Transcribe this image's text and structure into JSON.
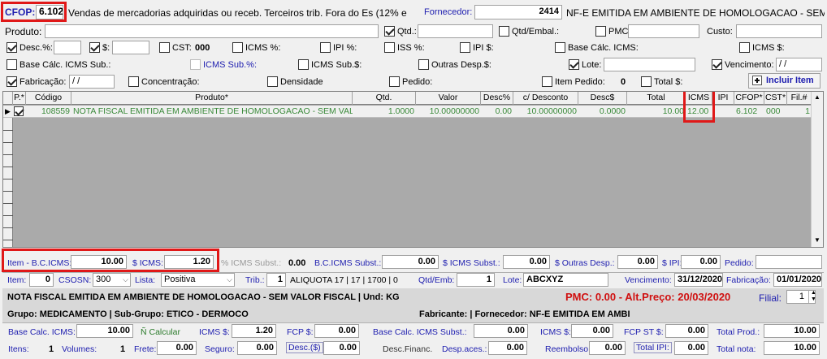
{
  "cfop": {
    "label": "CFOP:",
    "value": "6.102",
    "description": "Vendas de mercadorias adquiridas ou receb. Terceiros trib. Fora do Es (12% e"
  },
  "fornecedor": {
    "label": "Fornecedor:",
    "code": "2414",
    "name": "NF-E EMITIDA EM AMBIENTE DE HOMOLOGACAO - SEM V"
  },
  "produto_label": "Produto:",
  "checks": {
    "qtd": "Qtd.:",
    "qtd_embal": "Qtd/Embal.:",
    "pmc": "PMC:",
    "custo": "Custo:",
    "desc_pct": "Desc.%:",
    "dollar": "$:",
    "cst": "CST:",
    "cst_value": "000",
    "icms_pct": "ICMS %:",
    "ipi_pct": "IPI %:",
    "iss_pct": "ISS %:",
    "ipi_val": "IPI $:",
    "base_calc_icms": "Base Cálc. ICMS:",
    "icms_val": "ICMS $:",
    "base_calc_icms_sub": "Base Cálc. ICMS Sub.:",
    "icms_sub_pct": "ICMS Sub.%:",
    "icms_sub_val": "ICMS Sub.$:",
    "outras_desp": "Outras Desp.$:",
    "lote": "Lote:",
    "vencimento": "Vencimento:",
    "vencimento_value": "/  /",
    "fabricacao": "Fabricação:",
    "fabricacao_value": "/  /",
    "concentracao": "Concentração:",
    "densidade": "Densidade",
    "pedido": "Pedido:",
    "item_pedido": "Item Pedido:",
    "item_pedido_value": "0",
    "total_val": "Total $:"
  },
  "incluir_button": "Incluir Item",
  "grid": {
    "headers": [
      "P.*",
      "Código",
      "Produto*",
      "Qtd.",
      "Valor",
      "Desc%",
      "c/ Desconto",
      "Desc$",
      "Total",
      "ICMS",
      "IPI",
      "CFOP*",
      "CST*",
      "Fil.#"
    ],
    "row": {
      "codigo": "108559",
      "produto": "NOTA FISCAL EMITIDA EM AMBIENTE DE HOMOLOGACAO - SEM VALO",
      "qtd": "1.0000",
      "valor": "10.00000000",
      "desc_pct": "0.00",
      "c_desconto": "10.00000000",
      "desc_val": "0.0000",
      "total": "10.00",
      "icms": "12.00",
      "ipi": "",
      "cfop": "6.102",
      "cst": "000",
      "fil": "1"
    }
  },
  "row1": {
    "item_bc_icms_label": "Item - B.C.ICMS:",
    "item_bc_icms": "10.00",
    "icms_label": "$ ICMS:",
    "icms": "1.20",
    "icms_subst_pct_label": "% ICMS Subst.:",
    "icms_subst_pct": "0.00",
    "bc_icms_subst_label": "B.C.ICMS Subst.:",
    "bc_icms_subst": "0.00",
    "icms_subst_label": "$ ICMS Subst.:",
    "icms_subst": "0.00",
    "outras_desp_label": "$ Outras Desp.:",
    "outras_desp": "0.00",
    "ipi_label": "$ IPI:",
    "ipi": "0.00",
    "pedido_label": "Pedido:"
  },
  "row2": {
    "item_label": "Item:",
    "item": "0",
    "csosn_label": "CSOSN:",
    "csosn": "300",
    "lista_label": "Lista:",
    "lista": "Positiva",
    "trib_label": "Trib.:",
    "trib": "1",
    "aliquota": "ALIQUOTA 17 | 17 | 1700 | 0",
    "qtd_emb_label": "Qtd/Emb:",
    "qtd_emb": "1",
    "lote_label": "Lote:",
    "lote": "ABCXYZ",
    "vencimento_label": "Vencimento:",
    "vencimento": "31/12/2020",
    "fabricacao_label": "Fabricação:",
    "fabricacao": "01/01/2020"
  },
  "info": {
    "product_line": "NOTA FISCAL EMITIDA EM AMBIENTE DE HOMOLOGACAO - SEM VALOR FISCAL | Und: KG",
    "pmc": "PMC:     0.00 - Alt.Preço: 20/03/2020",
    "filial_label": "Filial:",
    "filial": "1",
    "grupo": "Grupo: MEDICAMENTO | Sub-Grupo: ETICO - DERMOCO",
    "fabricante": "Fabricante:  |  Fornecedor: NF-E EMITIDA EM AMBI"
  },
  "totals1": {
    "base_calc_icms_label": "Base Calc. ICMS:",
    "base_calc_icms": "10.00",
    "n_calcular": "Ñ Calcular",
    "icms_label": "ICMS $:",
    "icms": "1.20",
    "fcp_label": "FCP $:",
    "fcp": "0.00",
    "base_icms_subst_label": "Base Calc. ICMS Subst.:",
    "base_icms_subst": "0.00",
    "icms_val_label": "ICMS $:",
    "icms_val": "0.00",
    "fcp_st_label": "FCP ST $:",
    "fcp_st": "0.00",
    "total_prod_label": "Total Prod.:",
    "total_prod": "10.00"
  },
  "totals2": {
    "itens_label": "Itens:",
    "itens": "1",
    "volumes_label": "Volumes:",
    "volumes": "1",
    "frete_label": "Frete:",
    "frete": "0.00",
    "seguro_label": "Seguro:",
    "seguro": "0.00",
    "desc_label": "Desc.($)",
    "desc": "0.00",
    "desc_financ_label": "Desc.Financ.",
    "desp_aces_label": "Desp.aces.:",
    "desp_aces": "0.00",
    "reembolso_label": "Reembolso:",
    "reembolso": "0.00",
    "total_ipi_label": "Total IPI:",
    "total_ipi": "0.00",
    "total_nota_label": "Total nota:",
    "total_nota": "10.00"
  },
  "colors": {
    "highlight": "#e01818",
    "blue_label": "#2020b0",
    "grid_text": "#3a8a3a",
    "pmc_red": "#d01010"
  }
}
